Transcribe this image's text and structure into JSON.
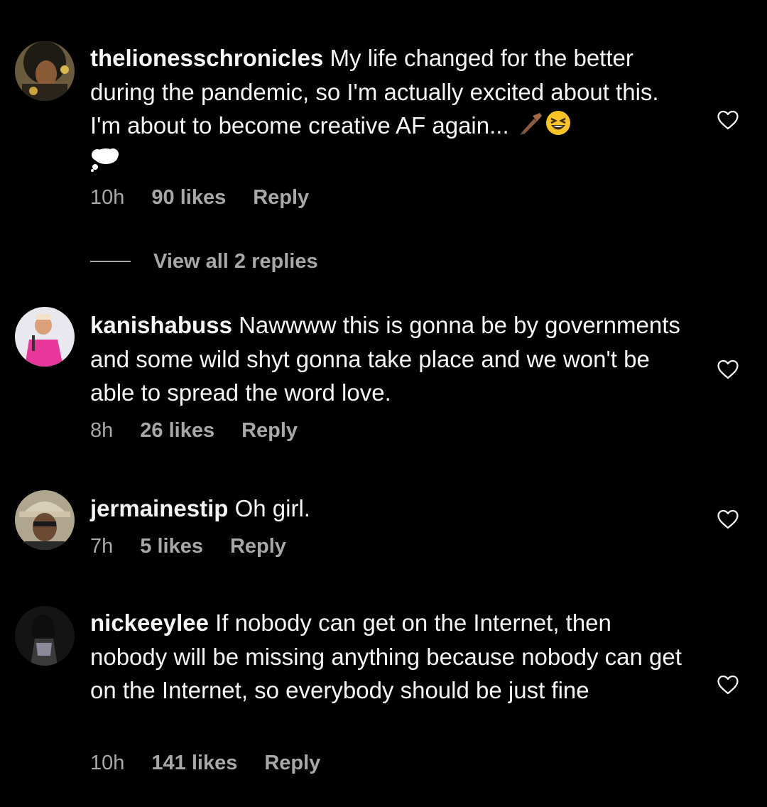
{
  "comments": [
    {
      "username": "thelionesschronicles",
      "text": "My life changed for the better during the pandemic, so I'm actually excited about this. I'm about to become creative AF again...",
      "time": "10h",
      "likes": "90 likes",
      "reply": "Reply",
      "emojis": [
        "writing-hand-emoji",
        "grinning-squinting-face-emoji",
        "thought-balloon-emoji"
      ]
    },
    {
      "username": "kanishabuss",
      "text": "Nawwww this is gonna be by governments and some wild shyt gonna take place and we won't be able to spread the word love.",
      "time": "8h",
      "likes": "26 likes",
      "reply": "Reply"
    },
    {
      "username": "jermainestip",
      "text": "Oh girl.",
      "time": "7h",
      "likes": "5 likes",
      "reply": "Reply"
    },
    {
      "username": "nickeeylee",
      "text": "If nobody can get on the Internet, then nobody will be missing anything because nobody can get on the Internet, so everybody should be just fine",
      "time": "10h",
      "likes": "141 likes",
      "reply": "Reply"
    }
  ],
  "view_replies": "View all 2 replies",
  "colors": {
    "background": "#000000",
    "primary_text": "#f5f5f5",
    "secondary_text": "#a8a8a8"
  },
  "icons": {
    "like": "heart-outline-icon"
  }
}
